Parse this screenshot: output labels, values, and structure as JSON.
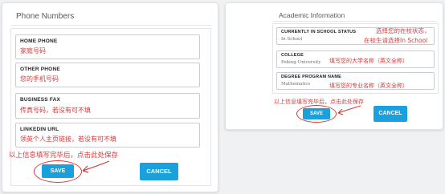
{
  "left_panel": {
    "title": "Phone Numbers",
    "fields": [
      {
        "label": "HOME PHONE",
        "value": "家庭号码"
      },
      {
        "label": "OTHER PHONE",
        "value": "您的手机号码"
      },
      {
        "label": "BUSINESS FAX",
        "value": "传真号码，若没有可不填"
      },
      {
        "label": "LINKEDIN URL",
        "value": "领英个人主页链接，若没有可不填"
      }
    ],
    "save_note": "以上信息填写完毕后，点击此处保存",
    "save_label": "SAVE",
    "cancel_label": "CANCEL"
  },
  "right_panel": {
    "title": "Academic Information",
    "fields": [
      {
        "label": "CURRENTLY IN SCHOOL STATUS",
        "value": "In School",
        "note_line1": "选择您的在校状态，",
        "note_line2": "在校生请选择In School"
      },
      {
        "label": "COLLEGE",
        "value": "Peking University",
        "note": "填写您的大学名称（英文全称）"
      },
      {
        "label": "DEGREE PROGRAM NAME",
        "value": "Mathematics",
        "note": "填写您的专业名称（英文全称）"
      }
    ],
    "save_note": "以上信息填写完毕后，点击此处保存",
    "save_label": "SAVE",
    "cancel_label": "CANCEL"
  },
  "colors": {
    "accent_blue": "#1aa0dc",
    "annotation_red": "#d63a3a",
    "field_border": "#c9ccd0"
  }
}
